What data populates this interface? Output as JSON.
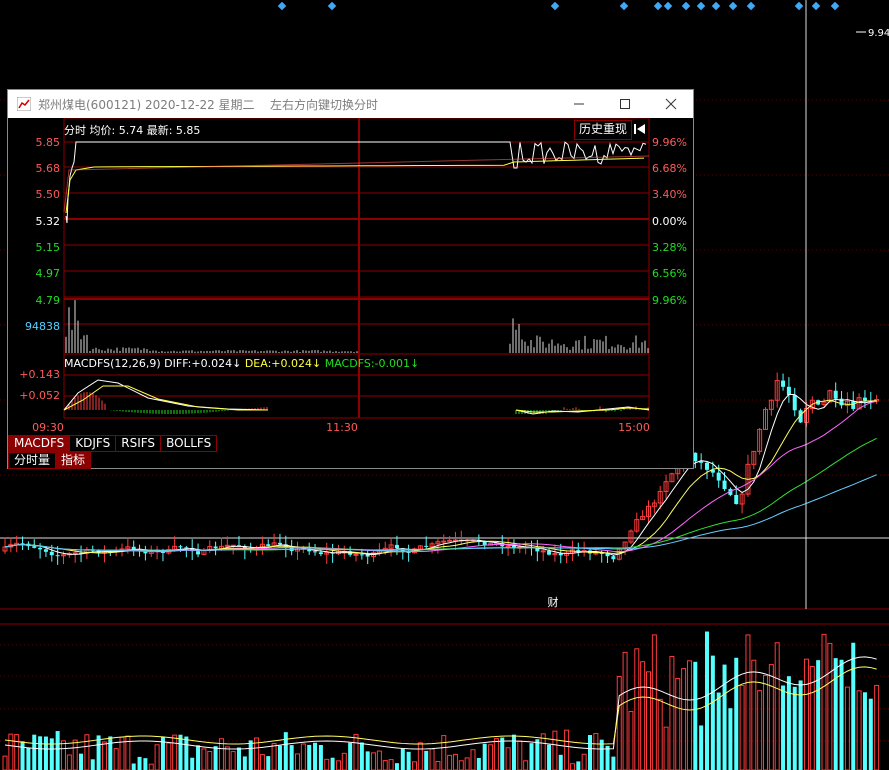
{
  "main_chart": {
    "high_label": "9.94",
    "finance_marker": "财"
  },
  "popup": {
    "title": "郑州煤电(600121) 2020-12-22 星期二",
    "hint": "左右方向键切换分时",
    "window_buttons": {
      "minimize": "☐",
      "maximize": "☐",
      "close": "✕"
    },
    "header": {
      "label": "分时 均价:",
      "avg_price": "5.74",
      "latest_label": "最新:",
      "latest": "5.85"
    },
    "replay_button": "历史重现",
    "price_axis": [
      "5.85",
      "5.68",
      "5.50",
      "5.32",
      "5.15",
      "4.97",
      "4.79"
    ],
    "pct_axis": [
      "9.96%",
      "6.68%",
      "3.40%",
      "0.00%",
      "3.28%",
      "6.56%",
      "9.96%"
    ],
    "volume_max": "94838",
    "macd": {
      "label": "MACDFS(12,26,9)",
      "diff_label": "DIFF:",
      "diff": "+0.024",
      "dea_label": "DEA:",
      "dea": "+0.024",
      "macd_label": "MACDFS:",
      "macd": "-0.001",
      "axis": [
        "+0.143",
        "+0.052"
      ]
    },
    "time_axis": [
      "09:30",
      "11:30",
      "15:00"
    ],
    "indicator_tabs": [
      "MACDFS",
      "KDJFS",
      "RSIFS",
      "BOLLFS"
    ],
    "bottom_tabs": [
      "分时量",
      "指标"
    ]
  },
  "colors": {
    "up": "#ff3b3b",
    "down": "#54ffff",
    "grid": "#8b0000",
    "yellow": "#ffff44",
    "green": "#22dd22"
  }
}
